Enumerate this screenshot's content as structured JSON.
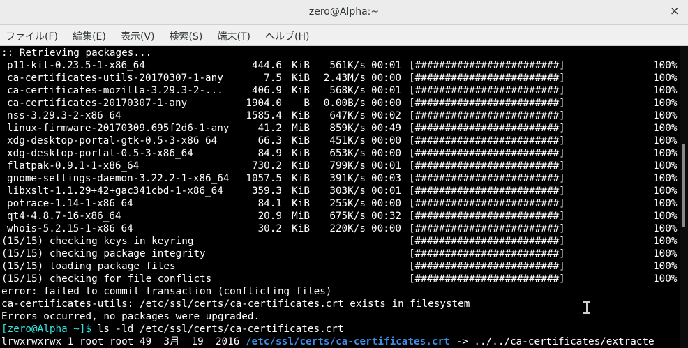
{
  "window": {
    "title": "zero@Alpha:~",
    "close_glyph": "×"
  },
  "menu": [
    "ファイル(F)",
    "編集(E)",
    "表示(V)",
    "検索(S)",
    "端末(T)",
    "ヘルプ(H)"
  ],
  "retrieving": ":: Retrieving packages...",
  "packages": [
    {
      "name": "p11-kit-0.23.5-1-x86_64",
      "size": "444.6",
      "unit": "KiB",
      "rate": "561K/s",
      "time": "00:01",
      "bar": "[########################]",
      "pct": "100%"
    },
    {
      "name": "ca-certificates-utils-20170307-1-any",
      "size": "7.5",
      "unit": "KiB",
      "rate": "2.43M/s",
      "time": "00:00",
      "bar": "[########################]",
      "pct": "100%"
    },
    {
      "name": "ca-certificates-mozilla-3.29.3-2-...",
      "size": "406.9",
      "unit": "KiB",
      "rate": "568K/s",
      "time": "00:01",
      "bar": "[########################]",
      "pct": "100%"
    },
    {
      "name": "ca-certificates-20170307-1-any",
      "size": "1904.0",
      "unit": "B",
      "rate": "0.00B/s",
      "time": "00:00",
      "bar": "[########################]",
      "pct": "100%"
    },
    {
      "name": "nss-3.29.3-2-x86_64",
      "size": "1585.4",
      "unit": "KiB",
      "rate": "647K/s",
      "time": "00:02",
      "bar": "[########################]",
      "pct": "100%"
    },
    {
      "name": "linux-firmware-20170309.695f2d6-1-any",
      "size": "41.2",
      "unit": "MiB",
      "rate": "859K/s",
      "time": "00:49",
      "bar": "[########################]",
      "pct": "100%"
    },
    {
      "name": "xdg-desktop-portal-gtk-0.5-3-x86_64",
      "size": "66.3",
      "unit": "KiB",
      "rate": "451K/s",
      "time": "00:00",
      "bar": "[########################]",
      "pct": "100%"
    },
    {
      "name": "xdg-desktop-portal-0.5-3-x86_64",
      "size": "84.9",
      "unit": "KiB",
      "rate": "653K/s",
      "time": "00:00",
      "bar": "[########################]",
      "pct": "100%"
    },
    {
      "name": "flatpak-0.9.1-1-x86_64",
      "size": "730.2",
      "unit": "KiB",
      "rate": "799K/s",
      "time": "00:01",
      "bar": "[########################]",
      "pct": "100%"
    },
    {
      "name": "gnome-settings-daemon-3.22.2-1-x86_64",
      "size": "1057.5",
      "unit": "KiB",
      "rate": "391K/s",
      "time": "00:03",
      "bar": "[########################]",
      "pct": "100%"
    },
    {
      "name": "libxslt-1.1.29+42+gac341cbd-1-x86_64",
      "size": "359.3",
      "unit": "KiB",
      "rate": "303K/s",
      "time": "00:01",
      "bar": "[########################]",
      "pct": "100%"
    },
    {
      "name": "potrace-1.14-1-x86_64",
      "size": "84.1",
      "unit": "KiB",
      "rate": "255K/s",
      "time": "00:00",
      "bar": "[########################]",
      "pct": "100%"
    },
    {
      "name": "qt4-4.8.7-16-x86_64",
      "size": "20.9",
      "unit": "MiB",
      "rate": "675K/s",
      "time": "00:32",
      "bar": "[########################]",
      "pct": "100%"
    },
    {
      "name": "whois-5.2.15-1-x86_64",
      "size": "30.2",
      "unit": "KiB",
      "rate": "220K/s",
      "time": "00:00",
      "bar": "[########################]",
      "pct": "100%"
    }
  ],
  "checks": [
    {
      "text": "(15/15) checking keys in keyring",
      "bar": "[########################]",
      "pct": "100%"
    },
    {
      "text": "(15/15) checking package integrity",
      "bar": "[########################]",
      "pct": "100%"
    },
    {
      "text": "(15/15) loading package files",
      "bar": "[########################]",
      "pct": "100%"
    },
    {
      "text": "(15/15) checking for file conflicts",
      "bar": "[########################]",
      "pct": "100%"
    }
  ],
  "error_line": "error: failed to commit transaction (conflicting files)",
  "conflict_line": "ca-certificates-utils: /etc/ssl/certs/ca-certificates.crt exists in filesystem",
  "errors_line": "Errors occurred, no packages were upgraded.",
  "prompt": {
    "text": "[zero@Alpha ~]$",
    "command": " ls -ld /etc/ssl/certs/ca-certificates.crt"
  },
  "ls_output": {
    "perms": "lrwxrwxrwx 1 root root 49  3月  19  2016 ",
    "path": "/etc/ssl/certs/ca-certificates.crt",
    "arrow": " -> ../../ca-certificates/extracte"
  },
  "colors": {
    "prompt": "#34e2e2",
    "link": "#3b8eea",
    "terminal_bg": "#000000",
    "titlebar_bg": "#ececec"
  }
}
